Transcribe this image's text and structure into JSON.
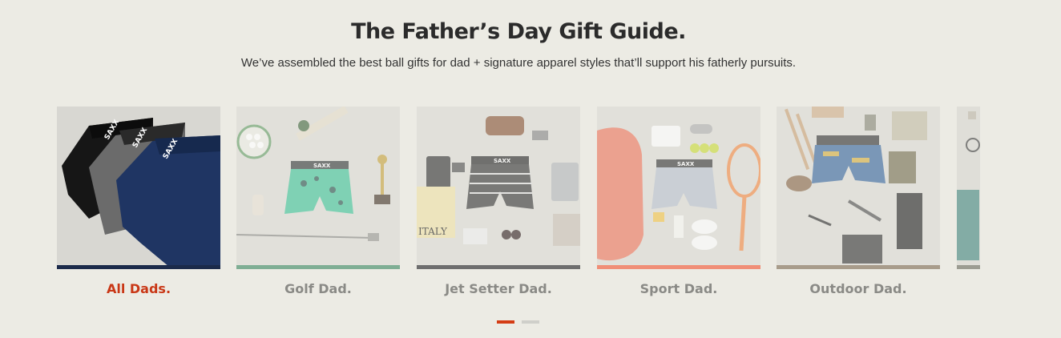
{
  "header": {
    "title": "The Father’s Day Gift Guide.",
    "subtitle": "We’ve assembled the best ball gifts for dad + signature apparel styles that’ll support his fatherly pursuits."
  },
  "cards": [
    {
      "label": "All Dads.",
      "accent": "#1b2a4a",
      "active": true,
      "image_icon": "boxer-briefs-stack-image"
    },
    {
      "label": "Golf Dad.",
      "accent": "#7fae94",
      "active": false,
      "image_icon": "golf-gifts-image"
    },
    {
      "label": "Jet Setter Dad.",
      "accent": "#6e6e6e",
      "active": false,
      "image_icon": "travel-gifts-image"
    },
    {
      "label": "Sport Dad.",
      "accent": "#f08e77",
      "active": false,
      "image_icon": "sport-gifts-image"
    },
    {
      "label": "Outdoor Dad.",
      "accent": "#a89c8b",
      "active": false,
      "image_icon": "outdoor-gifts-image"
    }
  ],
  "brand_text": "SAXX",
  "book_text": "ITALY",
  "pagination": {
    "pages": 2,
    "current": 1,
    "active_color": "#d43c14"
  }
}
